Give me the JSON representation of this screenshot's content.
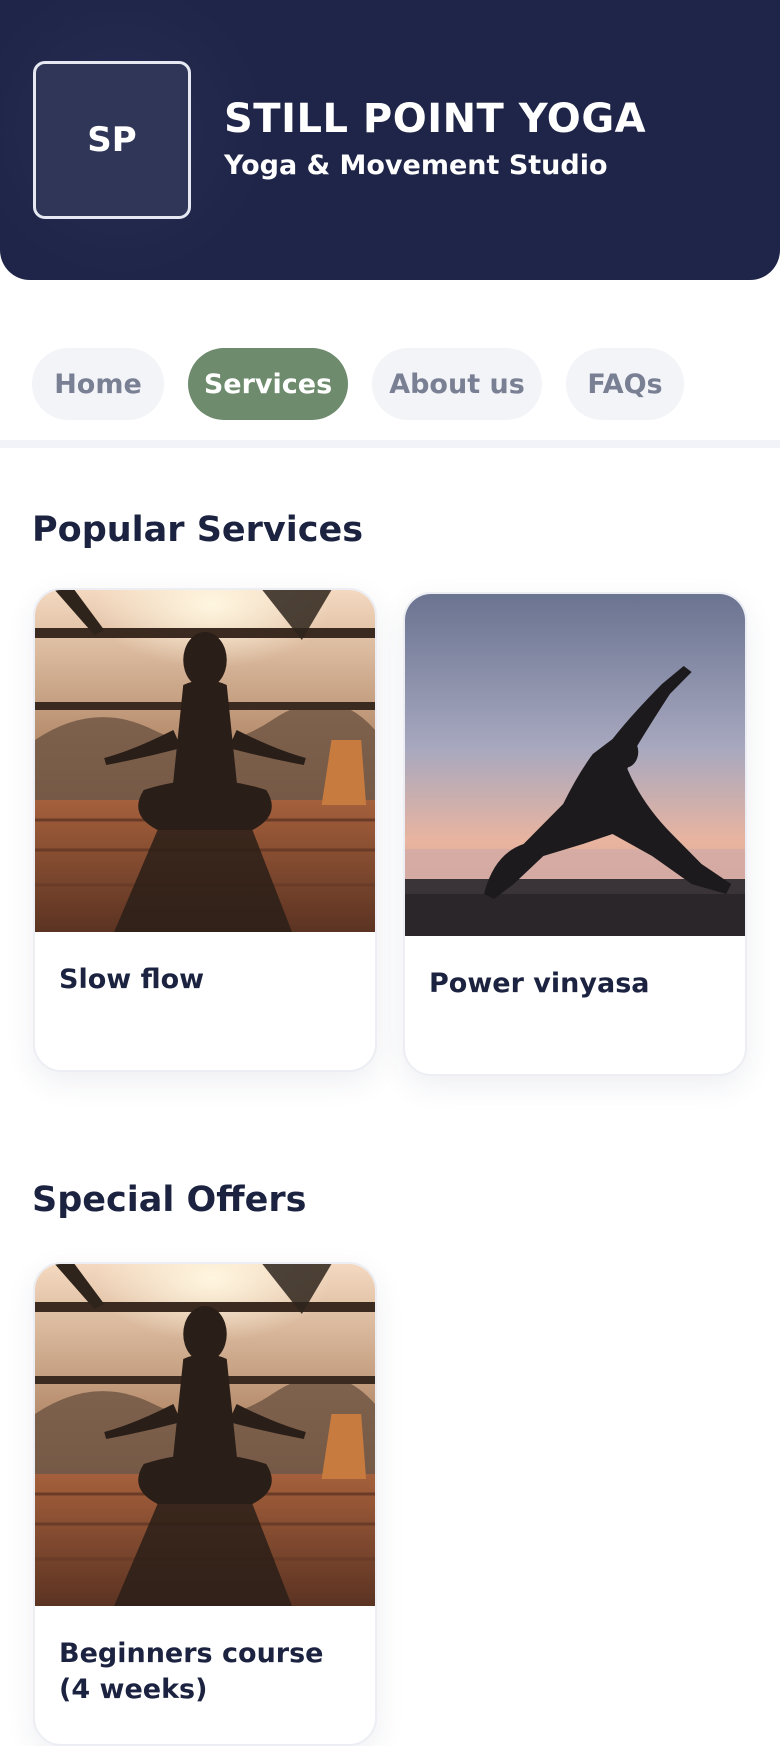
{
  "header": {
    "logo_initials": "SP",
    "title": "STILL POINT YOGA",
    "subtitle": "Yoga & Movement Studio"
  },
  "nav": {
    "items": [
      {
        "label": "Home",
        "active": false
      },
      {
        "label": "Services",
        "active": true
      },
      {
        "label": "About us",
        "active": false
      },
      {
        "label": "FAQs",
        "active": false
      }
    ]
  },
  "popular": {
    "title": "Popular Services",
    "cards": [
      {
        "label": "Slow flow",
        "image": "meditation-silhouette-photo"
      },
      {
        "label": "Power vinyasa",
        "image": "yoga-pose-sunset-photo"
      }
    ]
  },
  "offers": {
    "title": "Special Offers",
    "cards": [
      {
        "label": "Beginners course (4 weeks)",
        "image": "meditation-silhouette-photo"
      }
    ]
  },
  "colors": {
    "header_bg": "#1f2548",
    "accent": "#6e8b6d",
    "text": "#1c2340"
  }
}
